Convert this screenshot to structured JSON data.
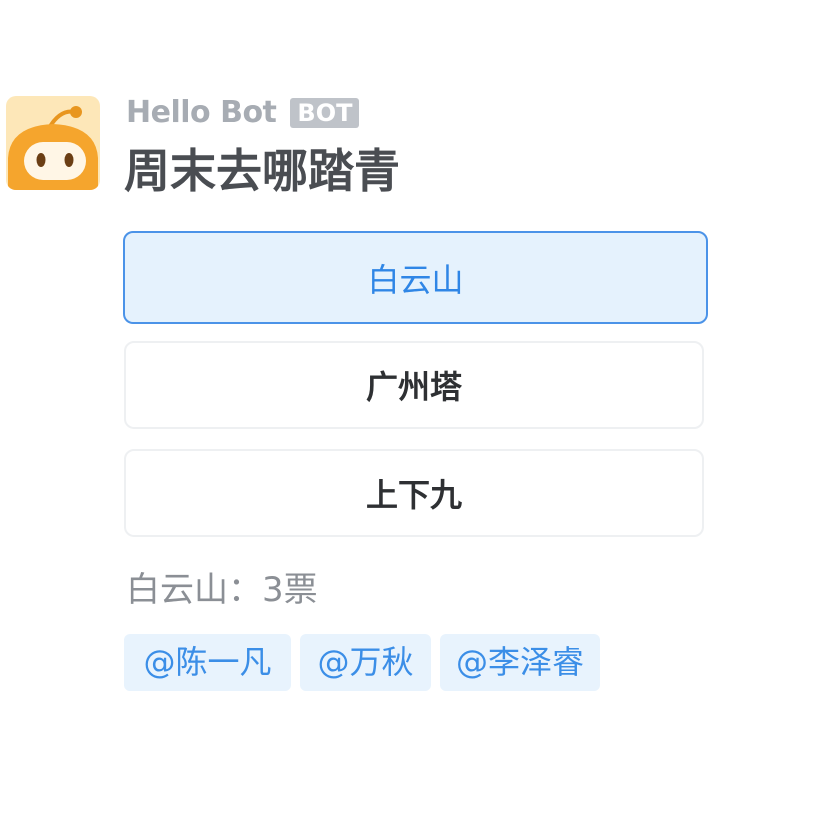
{
  "bot": {
    "name": "Hello Bot",
    "badge": "BOT",
    "avatar_icon": "bot-face-icon",
    "avatar_colors": {
      "background": "#fde7b8",
      "face": "#f5a52d",
      "eye": "#6b3e14",
      "antenna": "#e8961f"
    }
  },
  "poll": {
    "title": "周末去哪踏青",
    "options": [
      {
        "label": "白云山",
        "selected": true
      },
      {
        "label": "广州塔",
        "selected": false
      },
      {
        "label": "上下九",
        "selected": false
      }
    ],
    "result_text": "白云山：3票",
    "voters": [
      "@陈一凡",
      "@万秋",
      "@李泽睿"
    ]
  },
  "colors": {
    "accent": "#2f86e6",
    "selected_bg": "#e5f2fd",
    "selected_border": "#4b93e8",
    "tag_bg": "#e8f3fd"
  }
}
